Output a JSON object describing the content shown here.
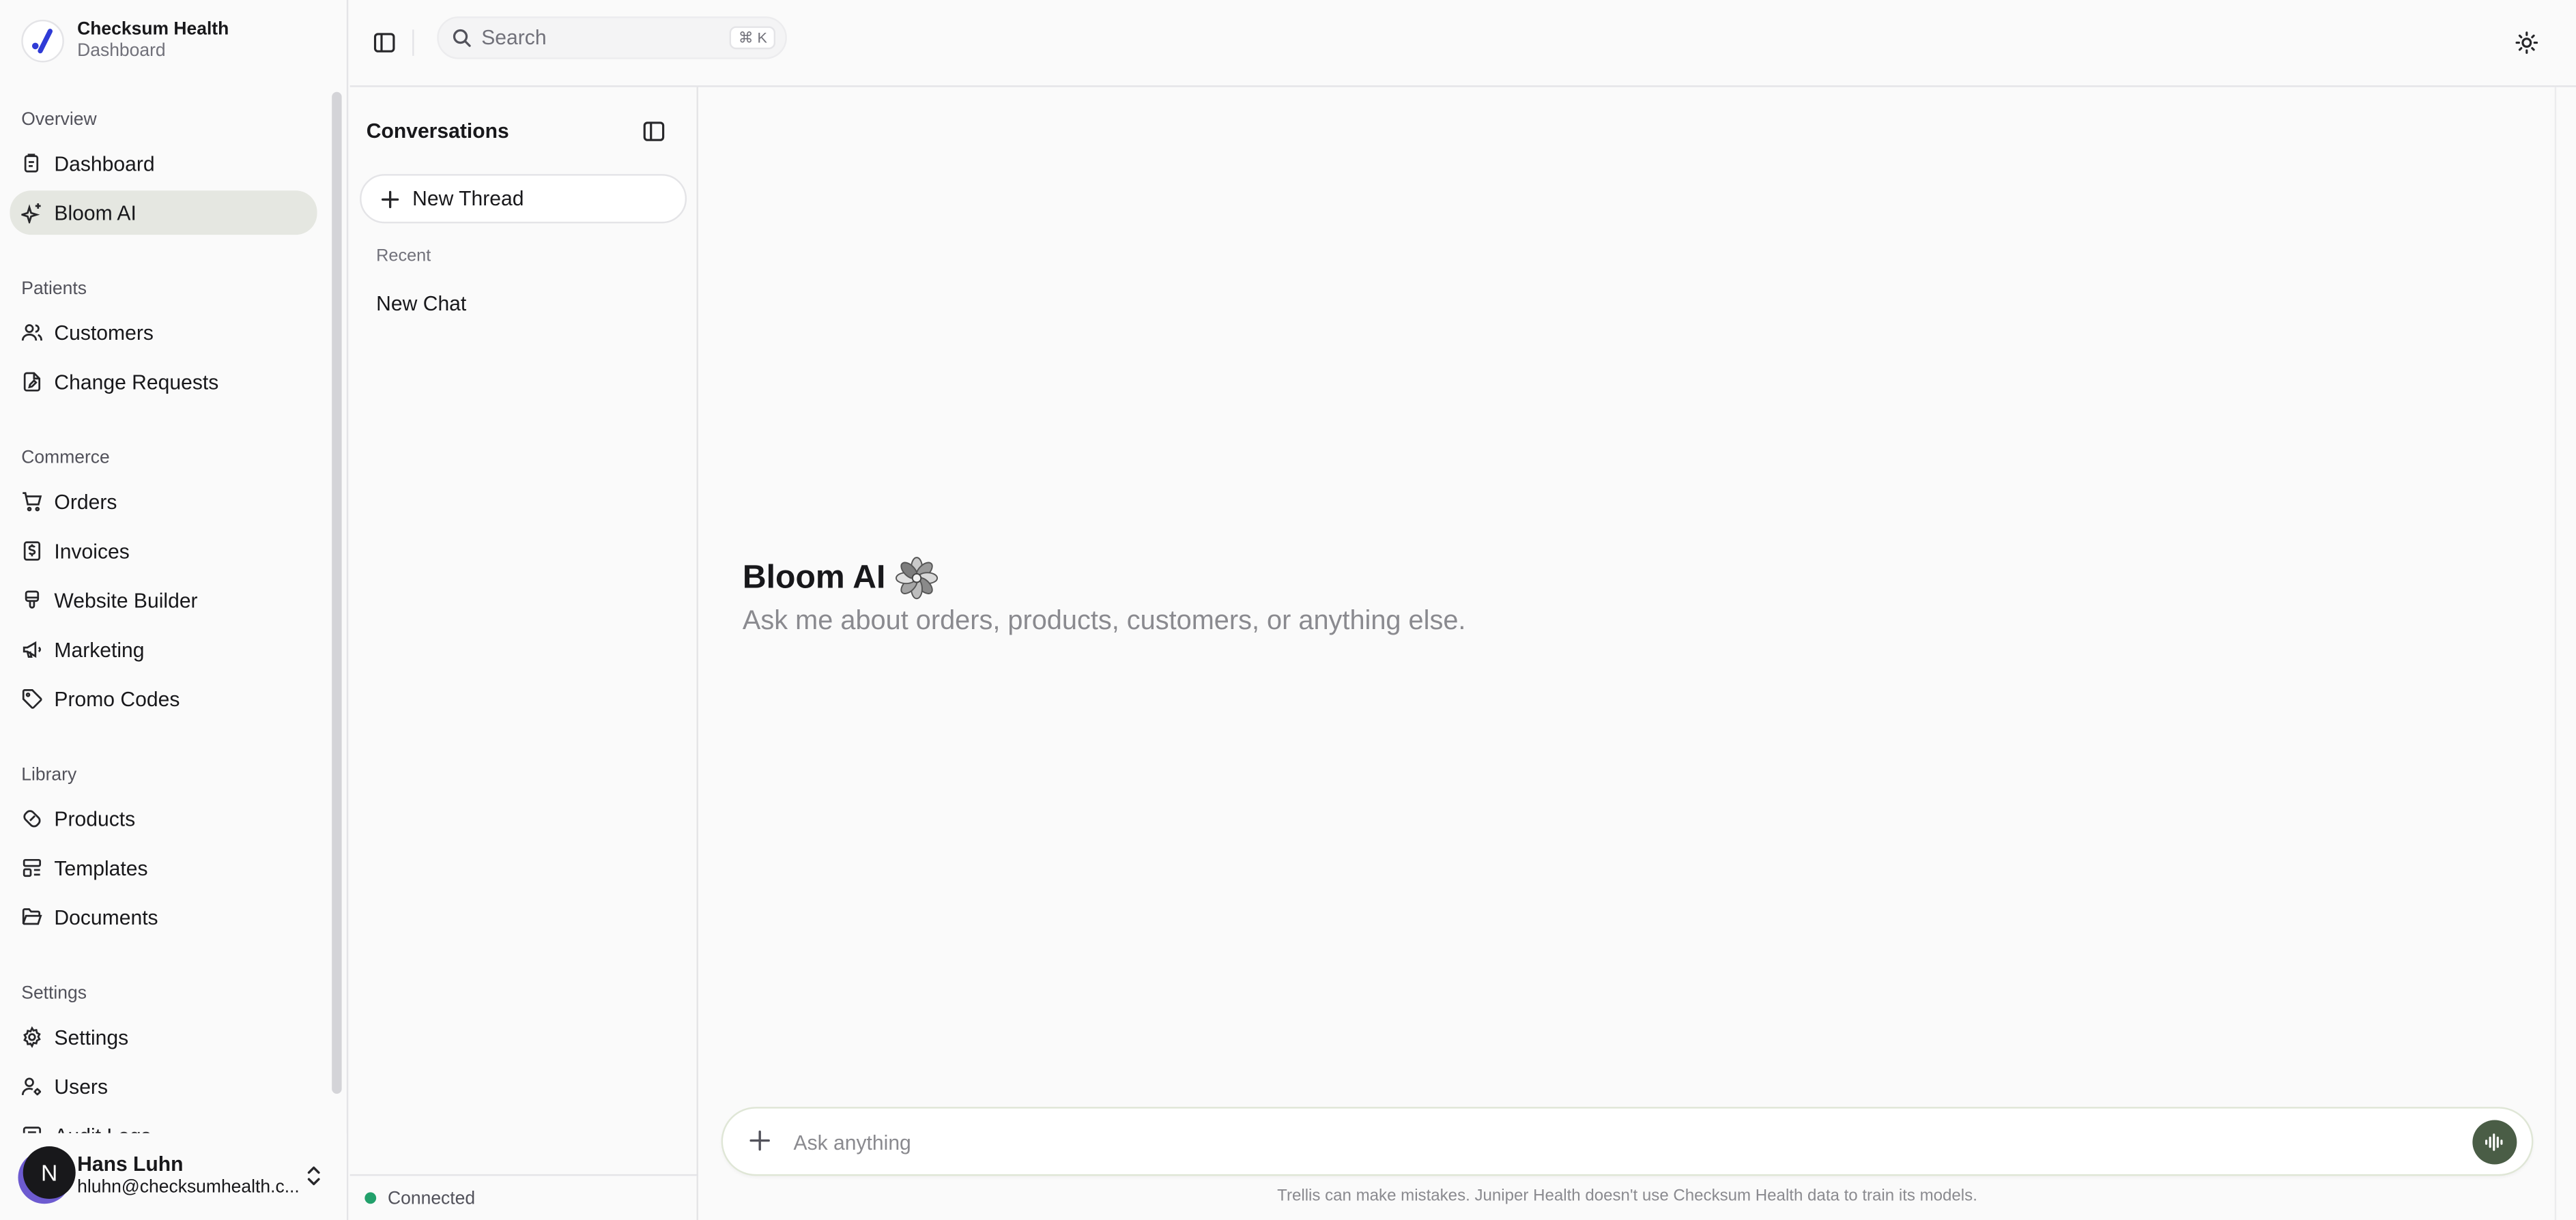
{
  "brand": {
    "name": "Checksum Health",
    "subtitle": "Dashboard"
  },
  "nav": {
    "groups": [
      {
        "label": "Overview",
        "items": [
          {
            "label": "Dashboard",
            "icon": "clipboard-icon"
          },
          {
            "label": "Bloom AI",
            "icon": "sparkles-icon",
            "active": true
          }
        ]
      },
      {
        "label": "Patients",
        "items": [
          {
            "label": "Customers",
            "icon": "users-icon"
          },
          {
            "label": "Change Requests",
            "icon": "file-edit-icon"
          }
        ]
      },
      {
        "label": "Commerce",
        "items": [
          {
            "label": "Orders",
            "icon": "cart-icon"
          },
          {
            "label": "Invoices",
            "icon": "dollar-doc-icon"
          },
          {
            "label": "Website Builder",
            "icon": "brush-icon"
          },
          {
            "label": "Marketing",
            "icon": "megaphone-icon"
          },
          {
            "label": "Promo Codes",
            "icon": "tag-icon"
          }
        ]
      },
      {
        "label": "Library",
        "items": [
          {
            "label": "Products",
            "icon": "pill-icon"
          },
          {
            "label": "Templates",
            "icon": "layout-icon"
          },
          {
            "label": "Documents",
            "icon": "folder-icon"
          }
        ]
      },
      {
        "label": "Settings",
        "items": [
          {
            "label": "Settings",
            "icon": "gear-icon"
          },
          {
            "label": "Users",
            "icon": "user-cog-icon"
          },
          {
            "label": "Audit Logs",
            "icon": "log-icon"
          }
        ]
      }
    ]
  },
  "user": {
    "initial": "N",
    "name": "Hans Luhn",
    "email": "hluhn@checksumhealth.c..."
  },
  "topbar": {
    "search_placeholder": "Search",
    "shortcut": "⌘ K"
  },
  "conversations": {
    "title": "Conversations",
    "new_thread_label": "New Thread",
    "recent_label": "Recent",
    "items": [
      "New Chat"
    ],
    "status": "Connected"
  },
  "main": {
    "title": "Bloom AI",
    "subtitle": "Ask me about orders, products, customers, or anything else.",
    "input_placeholder": "Ask anything",
    "disclaimer": "Trellis can make mistakes. Juniper Health doesn't use Checksum Health data to train its models."
  },
  "colors": {
    "accent": "#4a5d46",
    "active_nav": "#e5e7e1",
    "status_connected": "#22a06b"
  }
}
